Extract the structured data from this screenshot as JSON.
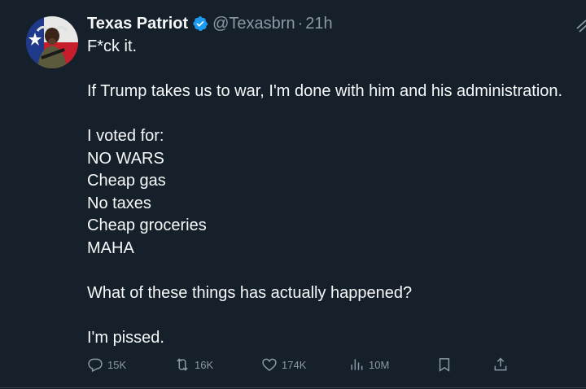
{
  "tweet": {
    "author_name": "Texas Patriot",
    "handle": "@Texasbrn",
    "separator": "·",
    "time": "21h",
    "verified": true,
    "lines": [
      "F*ck it.",
      "",
      "If Trump takes us to war, I'm done with him and his administration.",
      "",
      "I voted for:",
      "NO WARS",
      "Cheap gas",
      "No taxes",
      "Cheap groceries",
      "MAHA",
      "",
      "What of these things has actually happened?",
      "",
      "I'm pissed."
    ]
  },
  "actions": {
    "replies": "15K",
    "reposts": "16K",
    "likes": "174K",
    "views": "10M"
  },
  "icons": {
    "reply": "reply-icon",
    "repost": "repost-icon",
    "like": "like-icon",
    "views": "views-icon",
    "bookmark": "bookmark-icon",
    "share": "share-icon",
    "grok": "grok-icon",
    "verified": "verified-badge-icon"
  },
  "colors": {
    "background": "#15202b",
    "text": "#f7f9f9",
    "secondary": "#8b98a5",
    "verified": "#1d9bf0"
  }
}
